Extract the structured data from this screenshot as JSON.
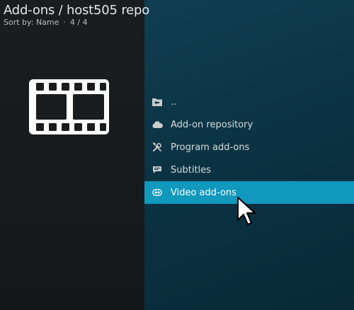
{
  "header": {
    "title": "Add-ons / host505 repo",
    "sort_label": "Sort by: Name",
    "item_count": "4 / 4"
  },
  "sidebar": {
    "category_icon": "film-strip-icon"
  },
  "menu": {
    "items": [
      {
        "label": "..",
        "icon": "back-folder-icon"
      },
      {
        "label": "Add-on repository",
        "icon": "cloud-icon"
      },
      {
        "label": "Program add-ons",
        "icon": "tools-icon"
      },
      {
        "label": "Subtitles",
        "icon": "speech-bubble-icon"
      },
      {
        "label": "Video add-ons",
        "icon": "video-reel-icon",
        "focused": true
      }
    ]
  },
  "colors": {
    "focus_highlight": "#1198bd",
    "right_panel": "#0b3343",
    "left_panel": "#1a1d1f"
  }
}
